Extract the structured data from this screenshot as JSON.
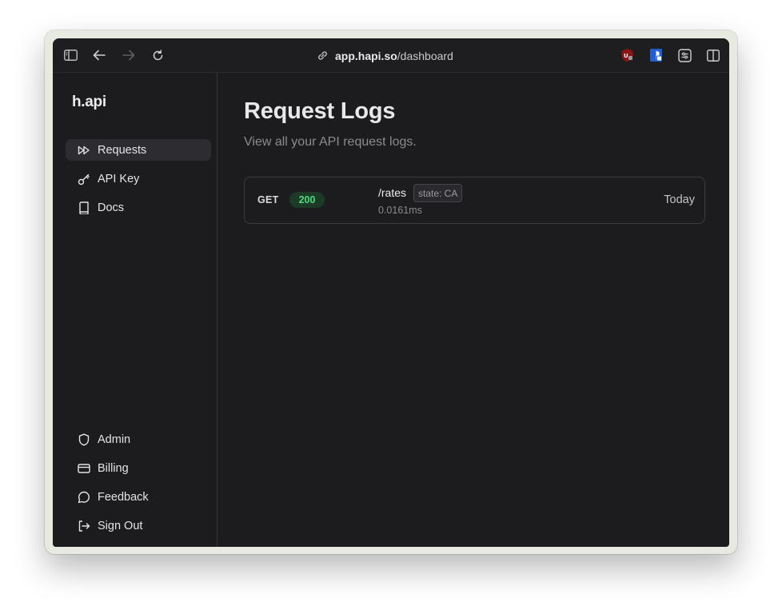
{
  "browser": {
    "url_domain": "app.hapi.so",
    "url_path": "/dashboard",
    "extensions": [
      "ublock-icon",
      "bitwarden-icon",
      "settings-sliders-icon"
    ]
  },
  "sidebar": {
    "logo": "h.api",
    "top_items": [
      {
        "label": "Requests",
        "icon": "fast-forward-icon",
        "active": true
      },
      {
        "label": "API Key",
        "icon": "key-icon",
        "active": false
      },
      {
        "label": "Docs",
        "icon": "book-icon",
        "active": false
      }
    ],
    "bottom_items": [
      {
        "label": "Admin",
        "icon": "shield-icon"
      },
      {
        "label": "Billing",
        "icon": "credit-card-icon"
      },
      {
        "label": "Feedback",
        "icon": "chat-bubble-icon"
      },
      {
        "label": "Sign Out",
        "icon": "sign-out-icon"
      }
    ]
  },
  "main": {
    "title": "Request Logs",
    "subtitle": "View all your API request logs.",
    "logs": [
      {
        "method": "GET",
        "status": "200",
        "path": "/rates",
        "param": "state: CA",
        "duration": "0.0161ms",
        "date": "Today"
      }
    ]
  },
  "colors": {
    "background": "#1c1c1f",
    "status_success_bg": "#1c3a26",
    "status_success_text": "#4ade80",
    "active_item_bg": "#2c2c31"
  }
}
